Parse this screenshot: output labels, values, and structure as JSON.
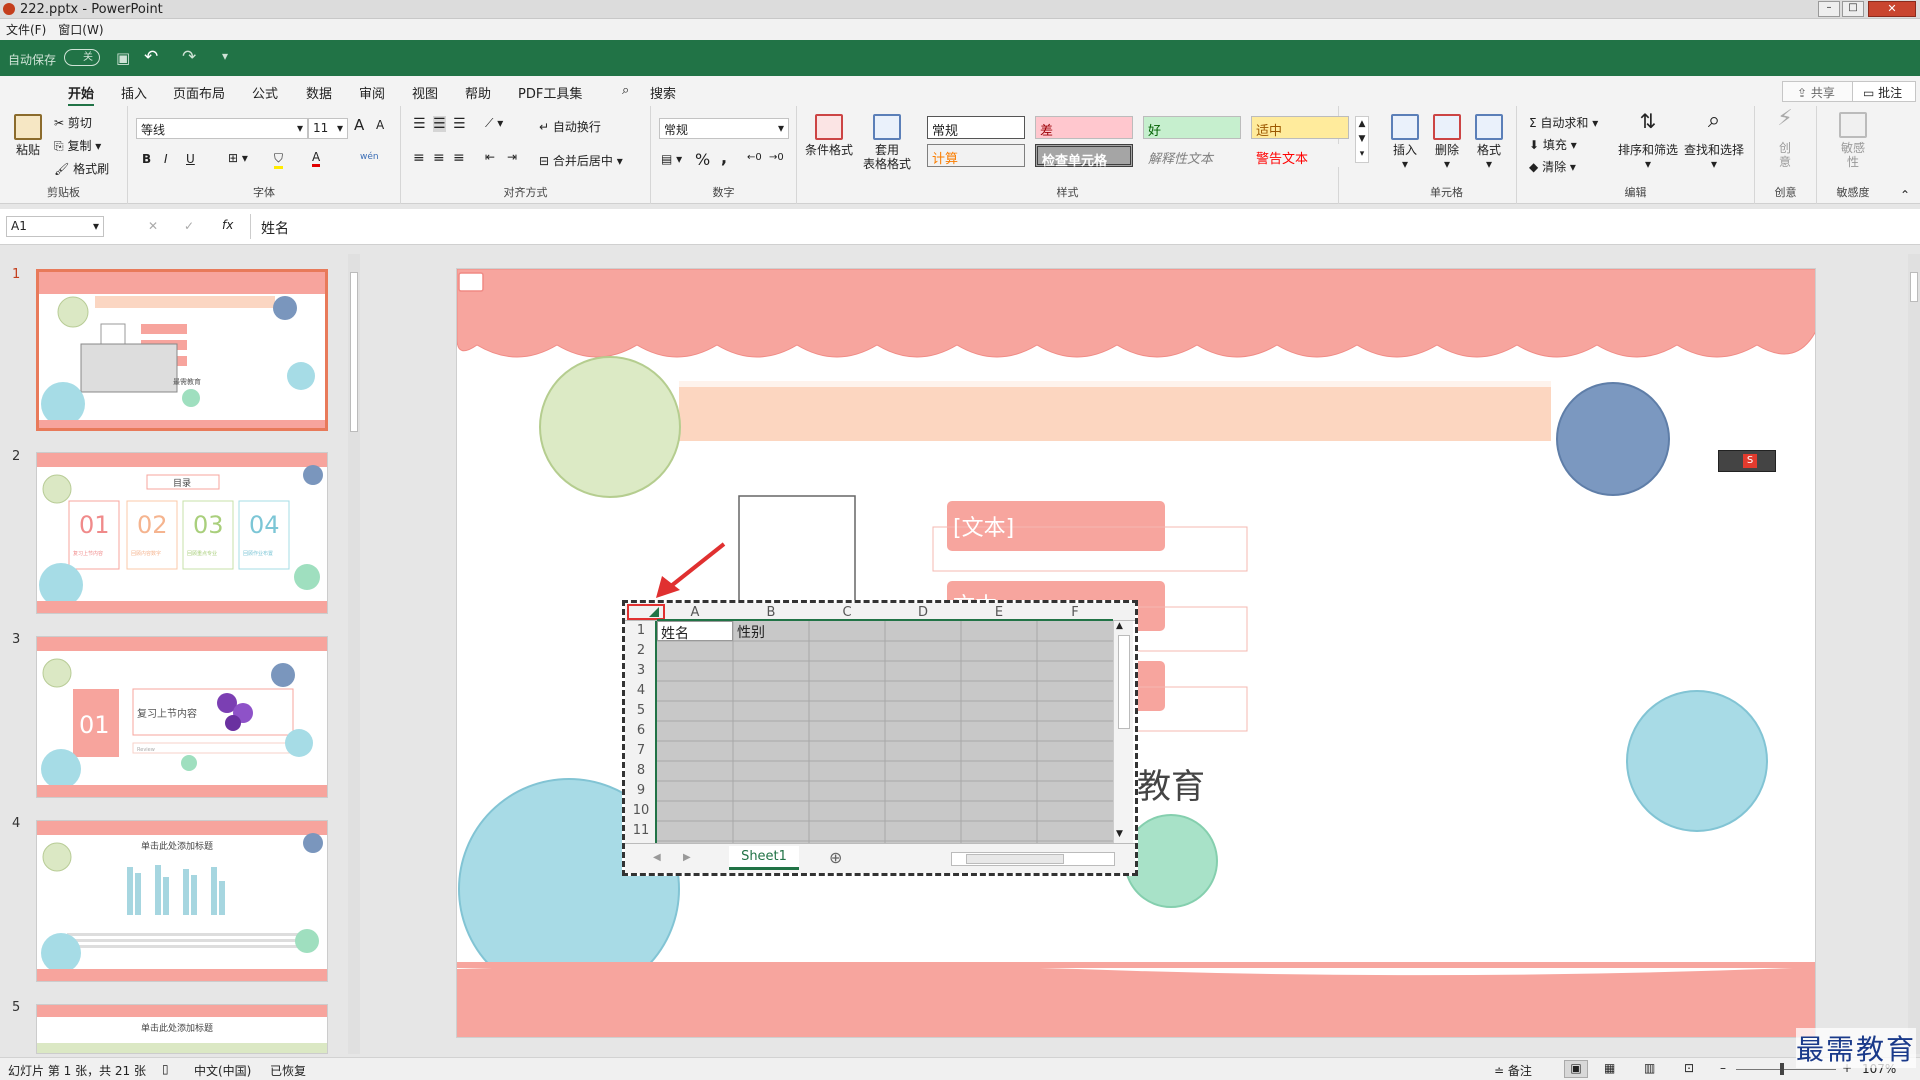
{
  "window": {
    "title": "222.pptx - PowerPoint"
  },
  "menu": {
    "file": "文件(F)",
    "window": "窗口(W)"
  },
  "qat": {
    "autosave": "自动保存",
    "toggle": "关"
  },
  "tabs": [
    "开始",
    "插入",
    "页面布局",
    "公式",
    "数据",
    "审阅",
    "视图",
    "帮助",
    "PDF工具集"
  ],
  "search": "搜索",
  "share": "共享",
  "comment": "批注",
  "clipboard": {
    "paste": "粘贴",
    "cut": "剪切",
    "copy": "复制",
    "format": "格式刷",
    "label": "剪贴板"
  },
  "font": {
    "name": "等线",
    "size": "11",
    "label": "字体",
    "bold": "B",
    "italic": "I",
    "underline": "U",
    "grow": "A",
    "shrink": "A",
    "fontcolor": "A",
    "wen": "wén"
  },
  "align": {
    "wrap": "自动换行",
    "merge": "合并后居中",
    "label": "对齐方式"
  },
  "number": {
    "format": "常规",
    "percent": "%",
    "comma": ",",
    "label": "数字"
  },
  "styles": {
    "cond": "条件格式",
    "table": "套用\n表格格式",
    "normal": "常规",
    "bad": "差",
    "good": "好",
    "neutral": "适中",
    "calc": "计算",
    "check": "检查单元格",
    "explain": "解释性文本",
    "warn": "警告文本",
    "label": "样式"
  },
  "cells": {
    "insert": "插入",
    "delete": "删除",
    "format": "格式",
    "label": "单元格"
  },
  "editing": {
    "autosum": "自动求和",
    "fill": "填充",
    "clear": "清除",
    "sort": "排序和筛选",
    "find": "查找和选择",
    "label": "编辑"
  },
  "ideas": {
    "create": "创\n意",
    "label": "创意"
  },
  "sensitivity": {
    "btn": "敏感\n性",
    "label": "敏感度"
  },
  "formula_bar": {
    "namebox": "A1",
    "cancel": "✕",
    "enter": "✓",
    "fx": "fx",
    "value": "姓名"
  },
  "thumbnails": [
    {
      "num": "1",
      "footer": "最需教育"
    },
    {
      "num": "2",
      "title": "目录",
      "items": [
        "01",
        "02",
        "03",
        "04"
      ],
      "subs": [
        "复习上节内容",
        "回顾内容数字",
        "回顾重点专业",
        "回顾作业布置"
      ]
    },
    {
      "num": "3",
      "big": "01",
      "title": "复习上节内容",
      "sub": "Review"
    },
    {
      "num": "4",
      "title": "单击此处添加标题"
    },
    {
      "num": "5",
      "title": "单击此处添加标题"
    }
  ],
  "slide": {
    "text1": "[文本]",
    "text2": "文本",
    "brand": "教育"
  },
  "excel": {
    "cols": [
      "A",
      "B",
      "C",
      "D",
      "E",
      "F"
    ],
    "rows": [
      "1",
      "2",
      "3",
      "4",
      "5",
      "6",
      "7",
      "8",
      "9",
      "10",
      "11"
    ],
    "a1": "姓名",
    "b1": "性别",
    "sheet": "Sheet1",
    "addsheet": "⊕"
  },
  "status": {
    "slide": "幻灯片 第 1 张，共 21 张",
    "lang": "中文(中国)",
    "recover": "已恢复",
    "notes": "备注",
    "zoom": "107%"
  },
  "watermark": "最需教育"
}
